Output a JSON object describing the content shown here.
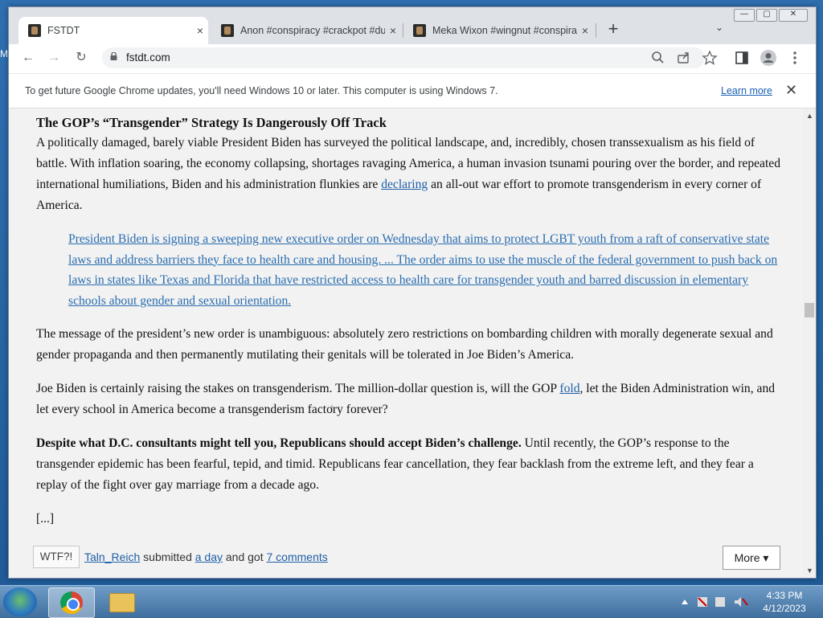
{
  "desktop": {
    "edge_text": "M"
  },
  "tabs": [
    {
      "title": "FSTDT",
      "close": "×",
      "active": true
    },
    {
      "title": "Anon #conspiracy #crackpot #du",
      "close": "×",
      "active": false
    },
    {
      "title": "Meka Wixon #wingnut #conspira",
      "close": "×",
      "active": false
    }
  ],
  "new_tab": "+",
  "tab_search": "⌄",
  "window_buttons": {
    "minimize": "—",
    "maximize": "▢",
    "close": "✕"
  },
  "toolbar": {
    "back": "←",
    "forward": "→",
    "reload": "↻",
    "url": "fstdt.com"
  },
  "infobar": {
    "text": "To get future Google Chrome updates, you'll need Windows 10 or later. This computer is using Windows 7.",
    "learn_more": "Learn more",
    "close": "✕"
  },
  "article": {
    "headline": "The GOP’s “Transgender” Strategy Is Dangerously Off Track",
    "p1_a": "A politically damaged, barely viable President Biden has surveyed the political landscape, and, incredibly, chosen transsexualism as his field of battle. With inflation soaring, the economy collapsing, shortages ravaging America, a human invasion tsunami pouring over the border, and repeated international humiliations, Biden and his administration flunkies are ",
    "p1_link": "declaring",
    "p1_b": " an all-out war effort to promote transgenderism in every corner of America.",
    "quote": "President Biden is signing a sweeping new executive order on Wednesday that aims to protect LGBT youth from a raft of conservative state laws and address barriers they face to health care and housing. ... The order aims to use the muscle of the federal government to push back on laws in states like Texas and Florida that have restricted access to health care for transgender youth and barred discussion in elementary schools about gender and sexual orientation.",
    "p2": "The message of the president’s new order is unambiguous: absolutely zero restrictions on bombarding children with morally degenerate sexual and gender propaganda and then permanently mutilating their genitals will be tolerated in Joe Biden’s America.",
    "p3_a": "Joe Biden is certainly raising the stakes on transgenderism. The million-dollar question is, will the GOP ",
    "p3_link": "fold",
    "p3_b": ", let the Biden Administration win, and let every school in America become a transgenderism factory forever?",
    "p4_bold": "Despite what D.C. consultants might tell you, Republicans should accept Biden’s challenge.",
    "p4_rest": " Until recently, the GOP’s response to the transgender epidemic has been fearful, tepid, and timid. Republicans fear cancellation, they fear backlash from the extreme left, and they fear a replay of the fight over gay marriage from a decade ago.",
    "ellipsis": "[...]"
  },
  "footer": {
    "wtf": "WTF?!",
    "author": "Taln_Reich",
    "submitted": " submitted ",
    "time": "a day",
    "got": " and got ",
    "comments": "7 comments",
    "more": "More ▾"
  },
  "taskbar": {
    "time": "4:33 PM",
    "date": "4/12/2023"
  }
}
